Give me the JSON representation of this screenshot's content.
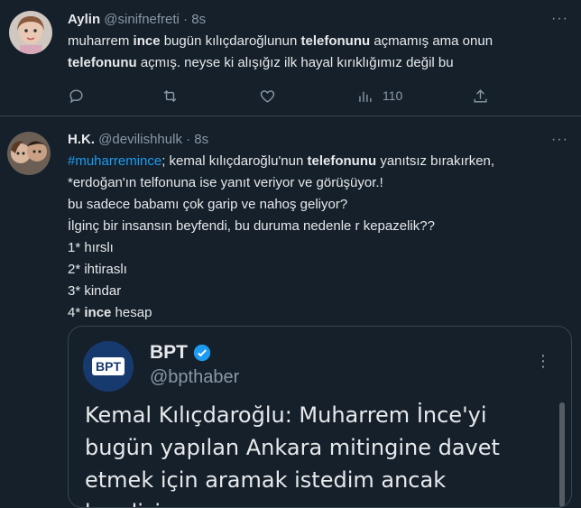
{
  "tweet1": {
    "name": "Aylin",
    "handle": "@sinifnefreti",
    "time": "8s",
    "more": "···",
    "lines": [
      [
        {
          "t": "muharrem ",
          "b": false
        },
        {
          "t": "ince",
          "b": true
        },
        {
          "t": " bugün kılıçdaroğlunun ",
          "b": false
        },
        {
          "t": "telefonunu",
          "b": true
        },
        {
          "t": " açmamış ama onun",
          "b": false
        }
      ],
      [
        {
          "t": "telefonunu",
          "b": true
        },
        {
          "t": " açmış. neyse ki alışığız ilk hayal kırıklığımız değil bu",
          "b": false
        }
      ]
    ],
    "actions": {
      "reply_icon": "reply-icon",
      "retweet_icon": "retweet-icon",
      "like_icon": "like-icon",
      "views_icon": "views-icon",
      "views_count": "110",
      "share_icon": "share-icon"
    }
  },
  "tweet2": {
    "name": "H.K.",
    "handle": "@devilishhulk",
    "time": "8s",
    "more": "···",
    "line1": {
      "hashtag": "#muharremince",
      "rest_a": "; kemal kılıçdaroğlu'nun ",
      "bold": "telefonunu",
      "rest_b": " yanıtsız bırakırken,"
    },
    "line2": "*erdoğan'ın telfonuna ise yanıt veriyor ve görüşüyor.!",
    "line3": "bu sadece babamı çok garip ve nahoş geliyor?",
    "line4": "İlginç bir insansın beyfendi, bu duruma nedenle r kepazelik??",
    "line5": "1* hırslı",
    "line6": "2* ihtiraslı",
    "line7": "3* kindar",
    "line8_a": "4* ",
    "line8_bold": "ince",
    "line8_b": " hesap"
  },
  "quote": {
    "name": "BPT",
    "handle": "@bpthaber",
    "more": "⋮",
    "logo_text": "BPT",
    "text_line1": "Kemal Kılıçdaroğlu: Muharrem İnce'yi",
    "text_line2": "bugün yapılan Ankara mitingine davet",
    "text_line3": "etmek için aramak istedim ancak kendisine"
  },
  "colors": {
    "background": "#15202b",
    "text": "#e7e9ea",
    "secondary": "#8b98a5",
    "accent": "#1d9bf0",
    "border": "#38444d"
  }
}
